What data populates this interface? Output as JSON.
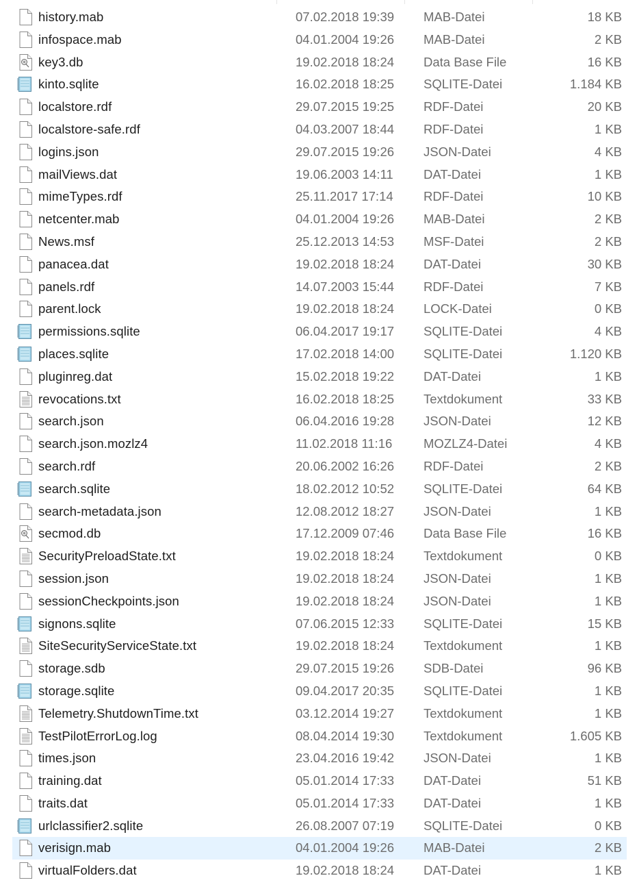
{
  "files": [
    {
      "name": "history.mab",
      "date": "07.02.2018 19:39",
      "type": "MAB-Datei",
      "size": "18 KB",
      "icon": "file-icon"
    },
    {
      "name": "infospace.mab",
      "date": "04.01.2004 19:26",
      "type": "MAB-Datei",
      "size": "2 KB",
      "icon": "file-icon"
    },
    {
      "name": "key3.db",
      "date": "19.02.2018 18:24",
      "type": "Data Base File",
      "size": "16 KB",
      "icon": "database-file-icon"
    },
    {
      "name": "kinto.sqlite",
      "date": "16.02.2018 18:25",
      "type": "SQLITE-Datei",
      "size": "1.184 KB",
      "icon": "sqlite-file-icon"
    },
    {
      "name": "localstore.rdf",
      "date": "29.07.2015 19:25",
      "type": "RDF-Datei",
      "size": "20 KB",
      "icon": "file-icon"
    },
    {
      "name": "localstore-safe.rdf",
      "date": "04.03.2007 18:44",
      "type": "RDF-Datei",
      "size": "1 KB",
      "icon": "file-icon"
    },
    {
      "name": "logins.json",
      "date": "29.07.2015 19:26",
      "type": "JSON-Datei",
      "size": "4 KB",
      "icon": "file-icon"
    },
    {
      "name": "mailViews.dat",
      "date": "19.06.2003 14:11",
      "type": "DAT-Datei",
      "size": "1 KB",
      "icon": "file-icon"
    },
    {
      "name": "mimeTypes.rdf",
      "date": "25.11.2017 17:14",
      "type": "RDF-Datei",
      "size": "10 KB",
      "icon": "file-icon"
    },
    {
      "name": "netcenter.mab",
      "date": "04.01.2004 19:26",
      "type": "MAB-Datei",
      "size": "2 KB",
      "icon": "file-icon"
    },
    {
      "name": "News.msf",
      "date": "25.12.2013 14:53",
      "type": "MSF-Datei",
      "size": "2 KB",
      "icon": "file-icon"
    },
    {
      "name": "panacea.dat",
      "date": "19.02.2018 18:24",
      "type": "DAT-Datei",
      "size": "30 KB",
      "icon": "file-icon"
    },
    {
      "name": "panels.rdf",
      "date": "14.07.2003 15:44",
      "type": "RDF-Datei",
      "size": "7 KB",
      "icon": "file-icon"
    },
    {
      "name": "parent.lock",
      "date": "19.02.2018 18:24",
      "type": "LOCK-Datei",
      "size": "0 KB",
      "icon": "file-icon"
    },
    {
      "name": "permissions.sqlite",
      "date": "06.04.2017 19:17",
      "type": "SQLITE-Datei",
      "size": "4 KB",
      "icon": "sqlite-file-icon"
    },
    {
      "name": "places.sqlite",
      "date": "17.02.2018 14:00",
      "type": "SQLITE-Datei",
      "size": "1.120 KB",
      "icon": "sqlite-file-icon"
    },
    {
      "name": "pluginreg.dat",
      "date": "15.02.2018 19:22",
      "type": "DAT-Datei",
      "size": "1 KB",
      "icon": "file-icon"
    },
    {
      "name": "revocations.txt",
      "date": "16.02.2018 18:25",
      "type": "Textdokument",
      "size": "33 KB",
      "icon": "text-file-icon"
    },
    {
      "name": "search.json",
      "date": "06.04.2016 19:28",
      "type": "JSON-Datei",
      "size": "12 KB",
      "icon": "file-icon"
    },
    {
      "name": "search.json.mozlz4",
      "date": "11.02.2018 11:16",
      "type": "MOZLZ4-Datei",
      "size": "4 KB",
      "icon": "file-icon"
    },
    {
      "name": "search.rdf",
      "date": "20.06.2002 16:26",
      "type": "RDF-Datei",
      "size": "2 KB",
      "icon": "file-icon"
    },
    {
      "name": "search.sqlite",
      "date": "18.02.2012 10:52",
      "type": "SQLITE-Datei",
      "size": "64 KB",
      "icon": "sqlite-file-icon"
    },
    {
      "name": "search-metadata.json",
      "date": "12.08.2012 18:27",
      "type": "JSON-Datei",
      "size": "1 KB",
      "icon": "file-icon"
    },
    {
      "name": "secmod.db",
      "date": "17.12.2009 07:46",
      "type": "Data Base File",
      "size": "16 KB",
      "icon": "database-file-icon"
    },
    {
      "name": "SecurityPreloadState.txt",
      "date": "19.02.2018 18:24",
      "type": "Textdokument",
      "size": "0 KB",
      "icon": "text-file-icon"
    },
    {
      "name": "session.json",
      "date": "19.02.2018 18:24",
      "type": "JSON-Datei",
      "size": "1 KB",
      "icon": "file-icon"
    },
    {
      "name": "sessionCheckpoints.json",
      "date": "19.02.2018 18:24",
      "type": "JSON-Datei",
      "size": "1 KB",
      "icon": "file-icon"
    },
    {
      "name": "signons.sqlite",
      "date": "07.06.2015 12:33",
      "type": "SQLITE-Datei",
      "size": "15 KB",
      "icon": "sqlite-file-icon"
    },
    {
      "name": "SiteSecurityServiceState.txt",
      "date": "19.02.2018 18:24",
      "type": "Textdokument",
      "size": "1 KB",
      "icon": "text-file-icon"
    },
    {
      "name": "storage.sdb",
      "date": "29.07.2015 19:26",
      "type": "SDB-Datei",
      "size": "96 KB",
      "icon": "file-icon"
    },
    {
      "name": "storage.sqlite",
      "date": "09.04.2017 20:35",
      "type": "SQLITE-Datei",
      "size": "1 KB",
      "icon": "sqlite-file-icon"
    },
    {
      "name": "Telemetry.ShutdownTime.txt",
      "date": "03.12.2014 19:27",
      "type": "Textdokument",
      "size": "1 KB",
      "icon": "text-file-icon"
    },
    {
      "name": "TestPilotErrorLog.log",
      "date": "08.04.2014 19:30",
      "type": "Textdokument",
      "size": "1.605 KB",
      "icon": "text-file-icon"
    },
    {
      "name": "times.json",
      "date": "23.04.2016 19:42",
      "type": "JSON-Datei",
      "size": "1 KB",
      "icon": "file-icon"
    },
    {
      "name": "training.dat",
      "date": "05.01.2014 17:33",
      "type": "DAT-Datei",
      "size": "51 KB",
      "icon": "file-icon"
    },
    {
      "name": "traits.dat",
      "date": "05.01.2014 17:33",
      "type": "DAT-Datei",
      "size": "1 KB",
      "icon": "file-icon"
    },
    {
      "name": "urlclassifier2.sqlite",
      "date": "26.08.2007 07:19",
      "type": "SQLITE-Datei",
      "size": "0 KB",
      "icon": "sqlite-file-icon"
    },
    {
      "name": "verisign.mab",
      "date": "04.01.2004 19:26",
      "type": "MAB-Datei",
      "size": "2 KB",
      "icon": "file-icon",
      "selected": true
    },
    {
      "name": "virtualFolders.dat",
      "date": "19.02.2018 18:24",
      "type": "DAT-Datei",
      "size": "1 KB",
      "icon": "file-icon"
    }
  ],
  "colors": {
    "selection": "#e5f3ff",
    "secondary_text": "#6d6d6d",
    "sqlite_icon": "#9fd3ea"
  }
}
